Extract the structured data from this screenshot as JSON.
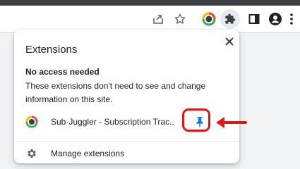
{
  "colors": {
    "accent_blue": "#1a73e8",
    "annotation_red": "#e01717",
    "toolbar_bg": "#ffffff",
    "popup_bg": "#ffffff"
  },
  "toolbar": {
    "icons": [
      "share-icon",
      "star-icon",
      "subjuggler-extension-icon",
      "extensions-puzzle-icon",
      "side-panel-icon",
      "profile-icon",
      "more-menu-icon"
    ]
  },
  "popup": {
    "title": "Extensions",
    "close_icon": "close-icon",
    "section_heading": "No access needed",
    "section_description": "These extensions don't need to see and change information on this site.",
    "extensions": [
      {
        "name": "Sub·Juggler - Subscription Trac...",
        "icon": "subjuggler-icon",
        "pin_icon": "pin-icon",
        "pinned": false
      }
    ],
    "manage_label": "Manage extensions",
    "manage_icon": "gear-icon"
  }
}
